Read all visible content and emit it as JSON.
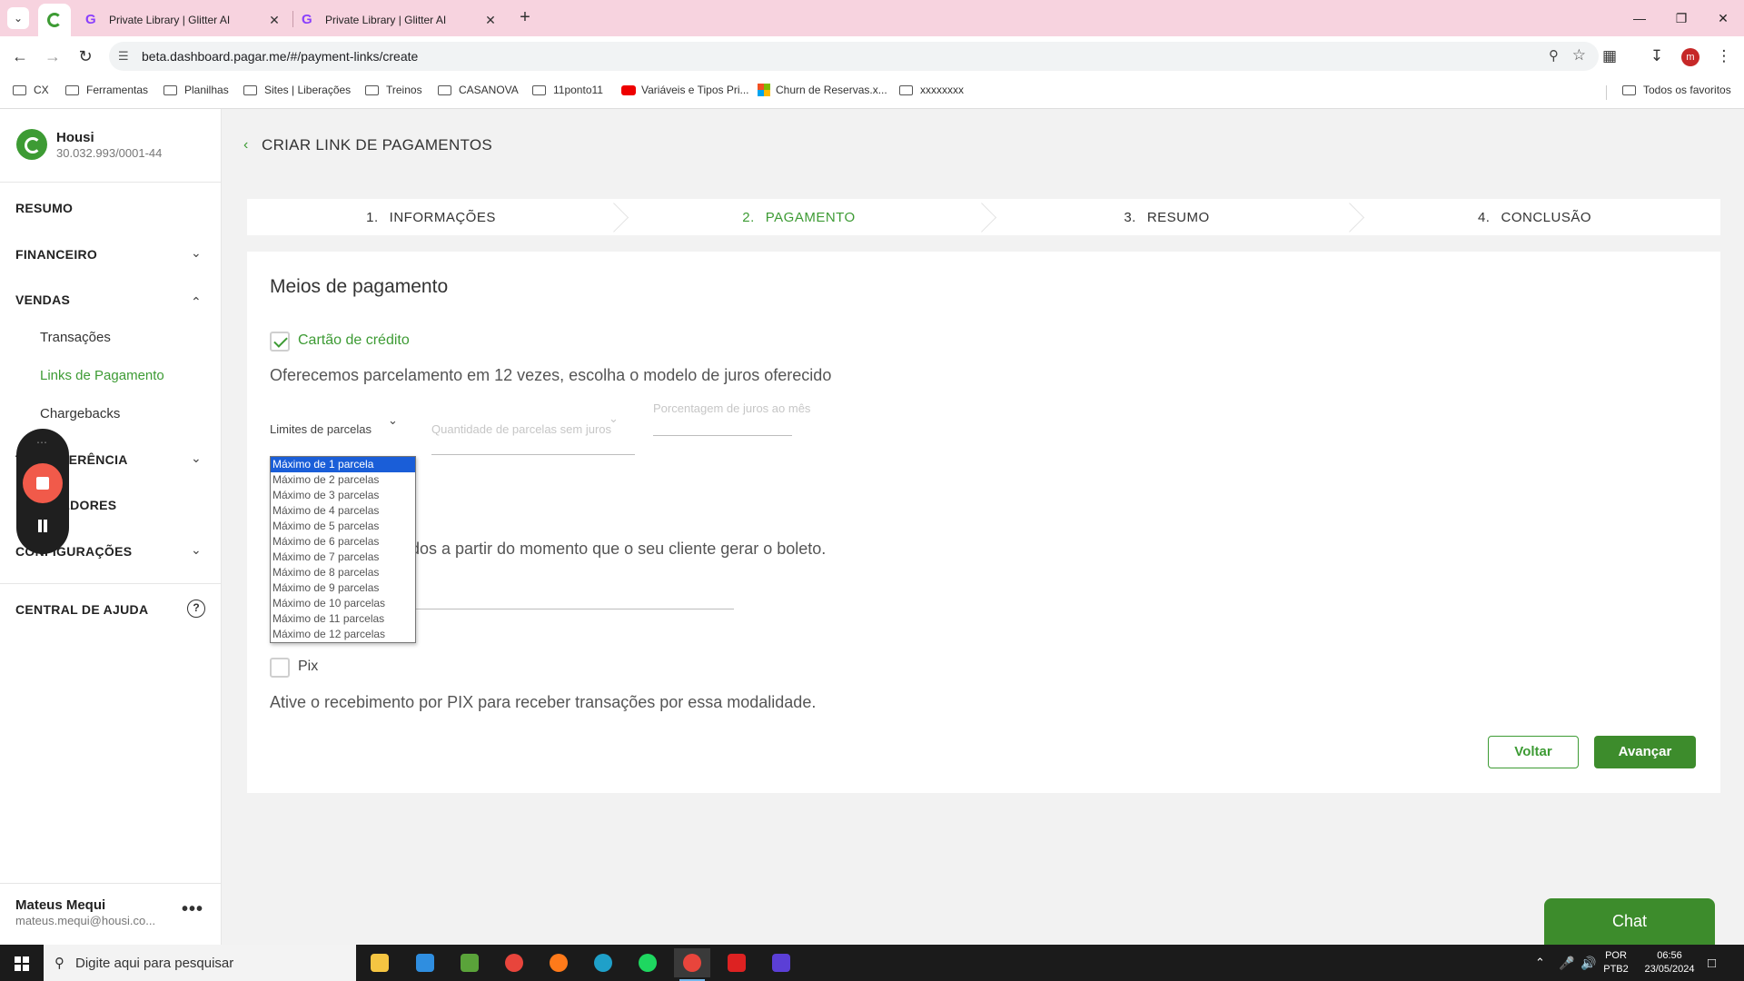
{
  "browser": {
    "tabs": [
      {
        "label": "Private Library | Glitter AI"
      },
      {
        "label": "Private Library | Glitter AI"
      }
    ],
    "url": "beta.dashboard.pagar.me/#/payment-links/create",
    "profile_initial": "m",
    "bookmarks": [
      "CX",
      "Ferramentas",
      "Planilhas",
      "Sites | Liberações",
      "Treinos",
      "CASANOVA",
      "11ponto11",
      "Variáveis e Tipos Pri...",
      "Churn de Reservas.x...",
      "xxxxxxxx"
    ],
    "all_favorites": "Todos os favoritos"
  },
  "sidebar": {
    "company_name": "Housi",
    "company_cnpj": "30.032.993/0001-44",
    "resumo": "RESUMO",
    "financeiro": "FINANCEIRO",
    "vendas": "VENDAS",
    "vendas_items": [
      "Transações",
      "Links de Pagamento",
      "Chargebacks"
    ],
    "transferencia": "TRANSFERÊNCIA",
    "recebedores": "RECEBEDORES",
    "configuracoes": "CONFIGURAÇÕES",
    "central_ajuda": "CENTRAL DE AJUDA",
    "user_name": "Mateus Mequi",
    "user_email": "mateus.mequi@housi.co..."
  },
  "page": {
    "title": "CRIAR LINK DE PAGAMENTOS",
    "steps": [
      {
        "num": "1.",
        "label": "INFORMAÇÕES"
      },
      {
        "num": "2.",
        "label": "PAGAMENTO"
      },
      {
        "num": "3.",
        "label": "RESUMO"
      },
      {
        "num": "4.",
        "label": "CONCLUSÃO"
      }
    ],
    "section_title": "Meios de pagamento",
    "credit_card_label": "Cartão de crédito",
    "credit_card_desc": "Oferecemos parcelamento em 12 vezes, escolha o modelo de juros oferecido",
    "field_limit_label": "Limites de parcelas",
    "field_no_interest_label": "Quantidade de parcelas sem juros",
    "field_interest_label": "Porcentagem de juros ao mês",
    "boleto_desc_partial": "dos a partir do momento que o seu cliente gerar o boleto.",
    "pix_label": "Pix",
    "pix_desc": "Ative o recebimento por PIX para receber transações por essa modalidade.",
    "btn_back": "Voltar",
    "btn_next": "Avançar",
    "chat": "Chat",
    "dropdown_options": [
      "Máximo de 1 parcela",
      "Máximo de 2 parcelas",
      "Máximo de 3 parcelas",
      "Máximo de 4 parcelas",
      "Máximo de 5 parcelas",
      "Máximo de 6 parcelas",
      "Máximo de 7 parcelas",
      "Máximo de 8 parcelas",
      "Máximo de 9 parcelas",
      "Máximo de 10 parcelas",
      "Máximo de 11 parcelas",
      "Máximo de 12 parcelas"
    ],
    "dropdown_selected_index": 0
  },
  "taskbar": {
    "search_placeholder": "Digite aqui para pesquisar",
    "lang_top": "POR",
    "lang_bottom": "PTB2",
    "time": "06:56",
    "date": "23/05/2024"
  },
  "colors": {
    "accent_green": "#3d9b34",
    "tabbar_pink": "#f7d3df",
    "selected_blue": "#1a5ed8"
  }
}
